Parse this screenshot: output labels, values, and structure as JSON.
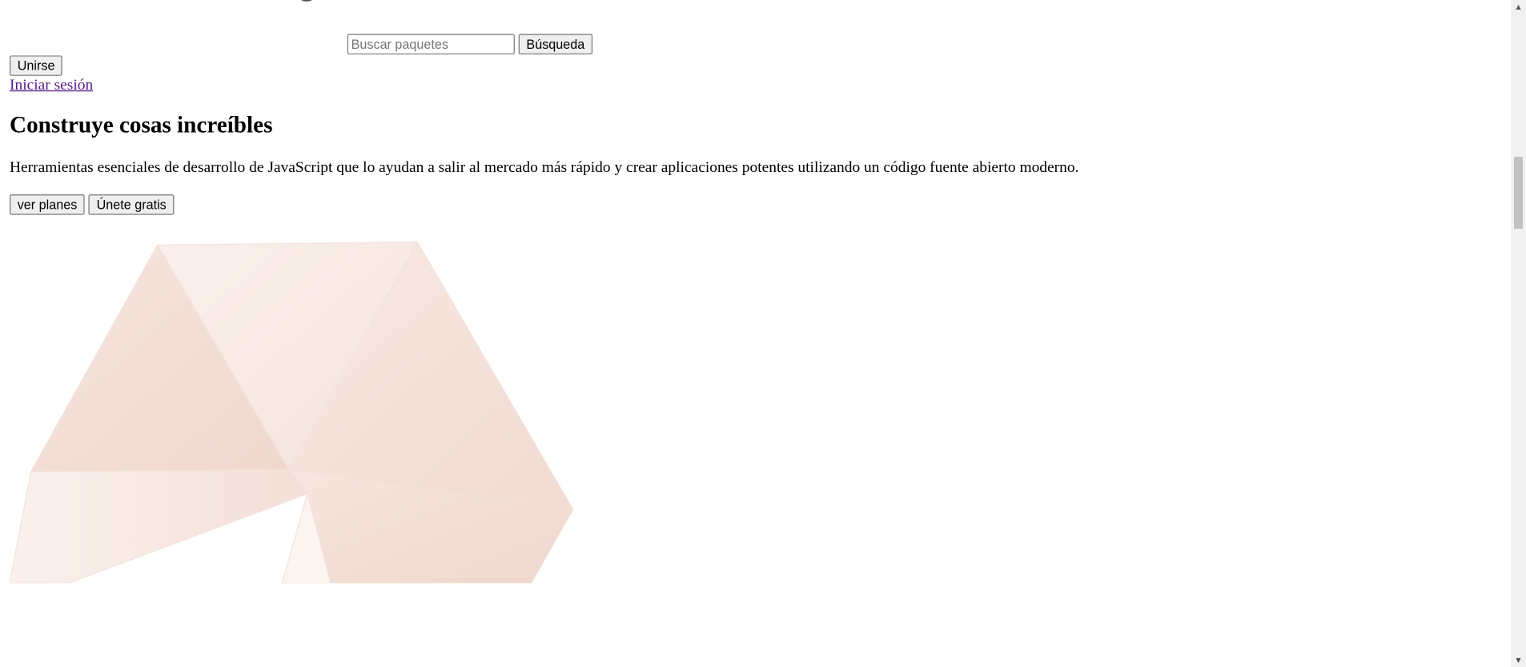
{
  "header": {
    "search": {
      "placeholder": "Buscar paquetes",
      "value": "",
      "button_label": "Búsqueda"
    },
    "join_label": "Unirse",
    "login_label": "Iniciar sesión"
  },
  "hero": {
    "title": "Construye cosas increíbles",
    "description": "Herramientas esenciales de desarrollo de JavaScript que lo ayudan a salir al mercado más rápido y crear aplicaciones potentes utilizando un código fuente abierto moderno.",
    "buttons": {
      "plans_label": "ver planes",
      "join_free_label": "Únete gratis"
    }
  },
  "icons": {
    "logo_fragment": "logo-icon",
    "hero_graphic": "hexagon-illustration",
    "scroll_up": "chevron-up-icon",
    "scroll_down": "chevron-down-icon"
  },
  "colors": {
    "link_visited": "#551a8b",
    "button_bg": "#efefef",
    "button_border": "#767676",
    "hero_graphic_base": "#f3ddd4",
    "logo_fragment": "#555555"
  }
}
